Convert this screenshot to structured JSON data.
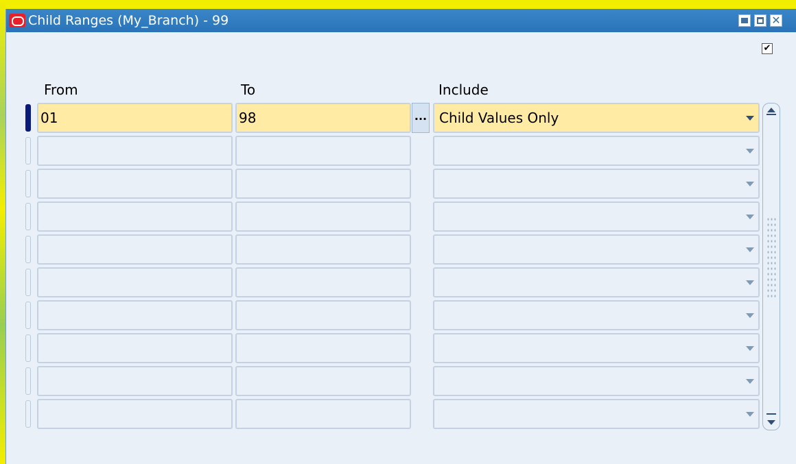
{
  "window": {
    "title": "Child Ranges (My_Branch) - 99",
    "close_glyph": "✕",
    "checkbox_checked": true,
    "checkbox_glyph": "✔"
  },
  "columns": {
    "from": "From",
    "to": "To",
    "include": "Include"
  },
  "rows": [
    {
      "from": "01",
      "to": "98",
      "include": "Child Values Only",
      "current": true
    },
    {
      "from": "",
      "to": "",
      "include": ""
    },
    {
      "from": "",
      "to": "",
      "include": ""
    },
    {
      "from": "",
      "to": "",
      "include": ""
    },
    {
      "from": "",
      "to": "",
      "include": ""
    },
    {
      "from": "",
      "to": "",
      "include": ""
    },
    {
      "from": "",
      "to": "",
      "include": ""
    },
    {
      "from": "",
      "to": "",
      "include": ""
    },
    {
      "from": "",
      "to": "",
      "include": ""
    },
    {
      "from": "",
      "to": "",
      "include": ""
    }
  ],
  "lov_button_label": "...",
  "icons": {
    "app": "oracle-icon",
    "minimize": "minimize-icon",
    "maximize": "maximize-icon",
    "close": "close-icon",
    "dropdown": "chevron-down-icon",
    "scroll_up": "scroll-up-icon",
    "scroll_down": "scroll-down-icon"
  },
  "colors": {
    "titlebar": "#2a73b9",
    "active_field": "#ffeba3",
    "window_bg": "#eaf0f8",
    "current_record": "#0a1a7a"
  }
}
